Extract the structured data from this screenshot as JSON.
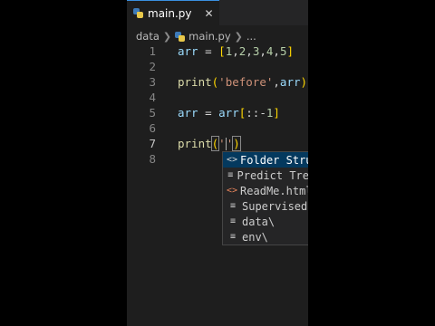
{
  "tab": {
    "filename": "main.py",
    "close_glyph": "✕"
  },
  "breadcrumb": {
    "folder": "data",
    "file": "main.py",
    "more": "..."
  },
  "code_lines": [
    {
      "number": "1",
      "text": "arr = [1,2,3,4,5]"
    },
    {
      "number": "2",
      "text": ""
    },
    {
      "number": "3",
      "text": "print('before',arr)"
    },
    {
      "number": "4",
      "text": ""
    },
    {
      "number": "5",
      "text": "arr = arr[::-1]"
    },
    {
      "number": "6",
      "text": ""
    },
    {
      "number": "7",
      "text": "print('')"
    },
    {
      "number": "8",
      "text": ""
    }
  ],
  "active_line": "7",
  "suggestions": [
    {
      "icon": "snippet-icon",
      "label": "Folder Stru",
      "selected": true
    },
    {
      "icon": "text-icon",
      "label": "Predict Tre",
      "selected": false
    },
    {
      "icon": "snippet-icon",
      "label": "ReadMe.html",
      "selected": false
    },
    {
      "icon": "text-icon",
      "label": "Supervised",
      "selected": false
    },
    {
      "icon": "text-icon",
      "label": "data\\",
      "selected": false
    },
    {
      "icon": "text-icon",
      "label": "env\\",
      "selected": false
    }
  ],
  "colors": {
    "editor_bg": "#1e1e1e",
    "tabbar_bg": "#252526",
    "keyword_var": "#9cdcfe",
    "function": "#dcdcaa",
    "number": "#b5cea8",
    "string": "#ce9178",
    "suggest_selected": "#04395e"
  }
}
